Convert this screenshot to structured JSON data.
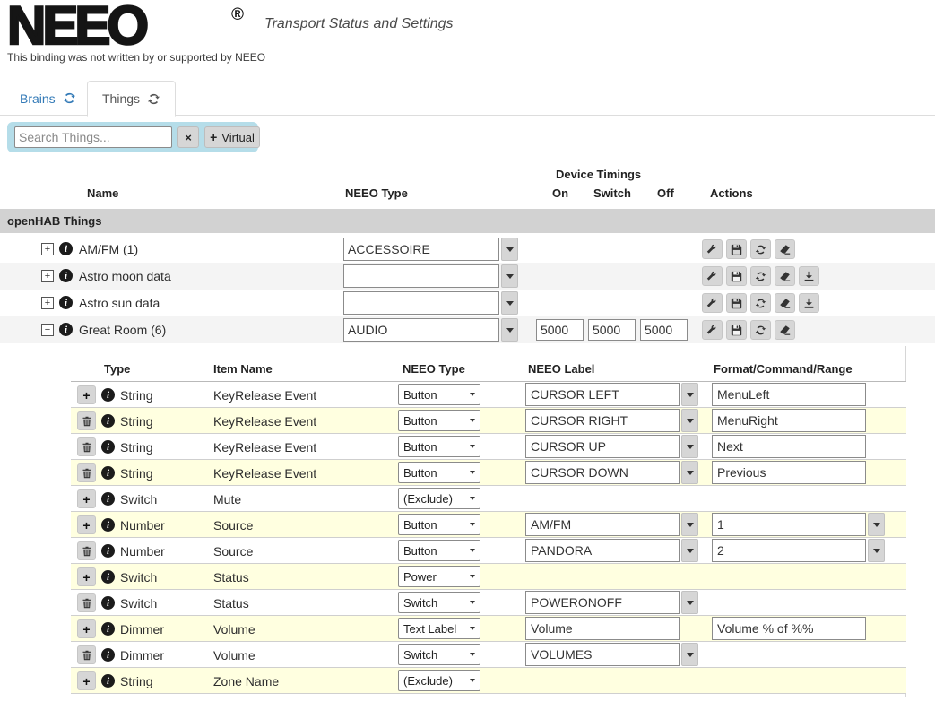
{
  "header": {
    "logo": "NEEO",
    "registered_mark": "®",
    "title": "Transport Status and Settings",
    "disclaimer": "This binding was not written by or supported by NEEO"
  },
  "tabs": [
    {
      "label": "Brains"
    },
    {
      "label": "Things"
    }
  ],
  "toolbar": {
    "search_placeholder": "Search Things...",
    "virtual_label": "Virtual"
  },
  "icons": {
    "plus": "+",
    "clear": "×",
    "expand": "+",
    "collapse": "−",
    "info": "i"
  },
  "colors": {
    "accent_blue": "#337ab7",
    "search_panel": "#b5dde9",
    "row_yellow": "#ffffe0",
    "row_stripe": "#f4f4f4",
    "section_gray": "#d2d2d2",
    "button_gray": "#d6d6d6"
  },
  "main_table": {
    "headers": {
      "name": "Name",
      "neeo_type": "NEEO Type",
      "device_timings": "Device Timings",
      "on": "On",
      "switch": "Switch",
      "off": "Off",
      "actions": "Actions"
    },
    "section_header": "openHAB Things",
    "rows": [
      {
        "name": "AM/FM (1)",
        "neeo_type": "ACCESSOIRE"
      },
      {
        "name": "Astro moon data",
        "neeo_type": ""
      },
      {
        "name": "Astro sun data",
        "neeo_type": ""
      },
      {
        "name": "Great Room (6)",
        "neeo_type": "AUDIO",
        "timings": {
          "on": "5000",
          "switch": "5000",
          "off": "5000"
        }
      }
    ]
  },
  "channel_table": {
    "headers": {
      "type": "Type",
      "item_name": "Item Name",
      "neeo_type": "NEEO Type",
      "neeo_label": "NEEO Label",
      "format": "Format/Command/Range"
    },
    "rows": [
      {
        "type": "String",
        "item_name": "KeyRelease Event",
        "neeo_type": "Button",
        "neeo_label": "CURSOR LEFT",
        "format": "MenuLeft"
      },
      {
        "type": "String",
        "item_name": "KeyRelease Event",
        "neeo_type": "Button",
        "neeo_label": "CURSOR RIGHT",
        "format": "MenuRight"
      },
      {
        "type": "String",
        "item_name": "KeyRelease Event",
        "neeo_type": "Button",
        "neeo_label": "CURSOR UP",
        "format": "Next"
      },
      {
        "type": "String",
        "item_name": "KeyRelease Event",
        "neeo_type": "Button",
        "neeo_label": "CURSOR DOWN",
        "format": "Previous"
      },
      {
        "type": "Switch",
        "item_name": "Mute",
        "neeo_type": "(Exclude)"
      },
      {
        "type": "Number",
        "item_name": "Source",
        "neeo_type": "Button",
        "neeo_label": "AM/FM",
        "format": "1"
      },
      {
        "type": "Number",
        "item_name": "Source",
        "neeo_type": "Button",
        "neeo_label": "PANDORA",
        "format": "2"
      },
      {
        "type": "Switch",
        "item_name": "Status",
        "neeo_type": "Power"
      },
      {
        "type": "Switch",
        "item_name": "Status",
        "neeo_type": "Switch",
        "neeo_label": "POWERONOFF"
      },
      {
        "type": "Dimmer",
        "item_name": "Volume",
        "neeo_type": "Text Label",
        "neeo_label": "Volume",
        "format": "Volume % of %%"
      },
      {
        "type": "Dimmer",
        "item_name": "Volume",
        "neeo_type": "Switch",
        "neeo_label": "VOLUMES"
      },
      {
        "type": "String",
        "item_name": "Zone Name",
        "neeo_type": "(Exclude)"
      }
    ]
  }
}
